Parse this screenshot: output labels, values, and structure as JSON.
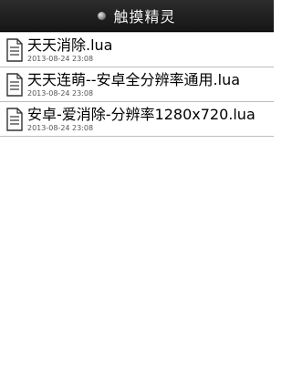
{
  "header": {
    "title": "触摸精灵"
  },
  "files": [
    {
      "name": "天天消除.lua",
      "date": "2013-08-24 23:08"
    },
    {
      "name": "天天连萌--安卓全分辨率通用.lua",
      "date": "2013-08-24 23:08"
    },
    {
      "name": "安卓-爱消除-分辨率1280x720.lua",
      "date": "2013-08-24 23:08"
    }
  ],
  "icons": {
    "app": "app-icon",
    "file": "document-icon"
  }
}
